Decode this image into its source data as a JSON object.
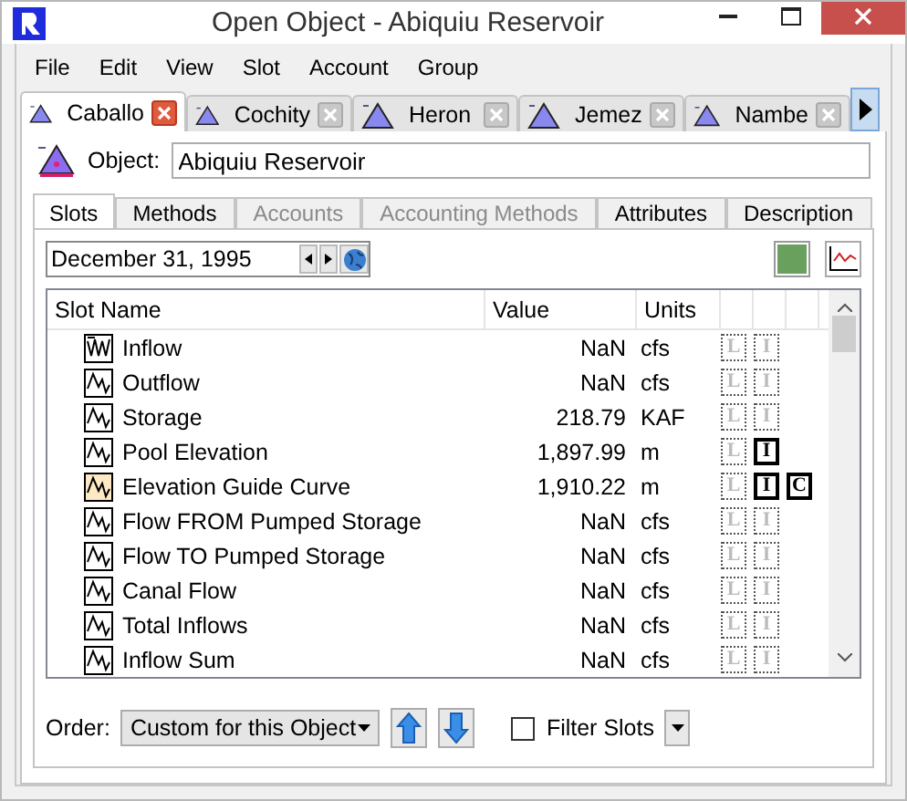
{
  "window": {
    "title": "Open Object - Abiquiu Reservoir"
  },
  "menu": [
    "File",
    "Edit",
    "View",
    "Slot",
    "Account",
    "Group"
  ],
  "object_tabs": [
    {
      "label": "Caballo",
      "selected": true
    },
    {
      "label": "Cochity",
      "selected": false
    },
    {
      "label": "Heron",
      "selected": false
    },
    {
      "label": "Jemez",
      "selected": false
    },
    {
      "label": "Nambe",
      "selected": false
    }
  ],
  "object": {
    "label": "Object:",
    "value": "Abiquiu Reservoir"
  },
  "slot_tabs": [
    {
      "label": "Slots",
      "selected": true,
      "disabled": false
    },
    {
      "label": "Methods",
      "selected": false,
      "disabled": false
    },
    {
      "label": "Accounts",
      "selected": false,
      "disabled": true
    },
    {
      "label": "Accounting Methods",
      "selected": false,
      "disabled": true
    },
    {
      "label": "Attributes",
      "selected": false,
      "disabled": false
    },
    {
      "label": "Description",
      "selected": false,
      "disabled": false
    }
  ],
  "date": "December 31, 1995",
  "table": {
    "columns": [
      "Slot Name",
      "Value",
      "Units"
    ],
    "rows": [
      {
        "kind": "multi",
        "tinted": false,
        "name": "Inflow",
        "value": "NaN",
        "units": "cfs",
        "flags": [
          {
            "letter": "L",
            "on": false
          },
          {
            "letter": "I",
            "on": false
          }
        ]
      },
      {
        "kind": "series",
        "tinted": false,
        "name": "Outflow",
        "value": "NaN",
        "units": "cfs",
        "flags": [
          {
            "letter": "L",
            "on": false
          },
          {
            "letter": "I",
            "on": false
          }
        ]
      },
      {
        "kind": "series",
        "tinted": false,
        "name": "Storage",
        "value": "218.79",
        "units": "KAF",
        "flags": [
          {
            "letter": "L",
            "on": false
          },
          {
            "letter": "I",
            "on": false
          }
        ]
      },
      {
        "kind": "series",
        "tinted": false,
        "name": "Pool Elevation",
        "value": "1,897.99",
        "units": "m",
        "flags": [
          {
            "letter": "L",
            "on": false
          },
          {
            "letter": "I",
            "on": true
          }
        ]
      },
      {
        "kind": "series",
        "tinted": true,
        "name": "Elevation Guide Curve",
        "value": "1,910.22",
        "units": "m",
        "flags": [
          {
            "letter": "L",
            "on": false
          },
          {
            "letter": "I",
            "on": true
          },
          {
            "letter": "C",
            "on": true
          }
        ]
      },
      {
        "kind": "series",
        "tinted": false,
        "name": "Flow FROM Pumped Storage",
        "value": "NaN",
        "units": "cfs",
        "flags": [
          {
            "letter": "L",
            "on": false
          },
          {
            "letter": "I",
            "on": false
          }
        ]
      },
      {
        "kind": "series",
        "tinted": false,
        "name": "Flow TO Pumped Storage",
        "value": "NaN",
        "units": "cfs",
        "flags": [
          {
            "letter": "L",
            "on": false
          },
          {
            "letter": "I",
            "on": false
          }
        ]
      },
      {
        "kind": "series",
        "tinted": false,
        "name": "Canal Flow",
        "value": "NaN",
        "units": "cfs",
        "flags": [
          {
            "letter": "L",
            "on": false
          },
          {
            "letter": "I",
            "on": false
          }
        ]
      },
      {
        "kind": "series",
        "tinted": false,
        "name": "Total Inflows",
        "value": "NaN",
        "units": "cfs",
        "flags": [
          {
            "letter": "L",
            "on": false
          },
          {
            "letter": "I",
            "on": false
          }
        ]
      },
      {
        "kind": "series",
        "tinted": false,
        "name": "Inflow Sum",
        "value": "NaN",
        "units": "cfs",
        "flags": [
          {
            "letter": "L",
            "on": false
          },
          {
            "letter": "I",
            "on": false
          }
        ]
      }
    ]
  },
  "order": {
    "label": "Order:",
    "value": "Custom for this Object"
  },
  "filter": {
    "label": "Filter Slots",
    "checked": false
  }
}
